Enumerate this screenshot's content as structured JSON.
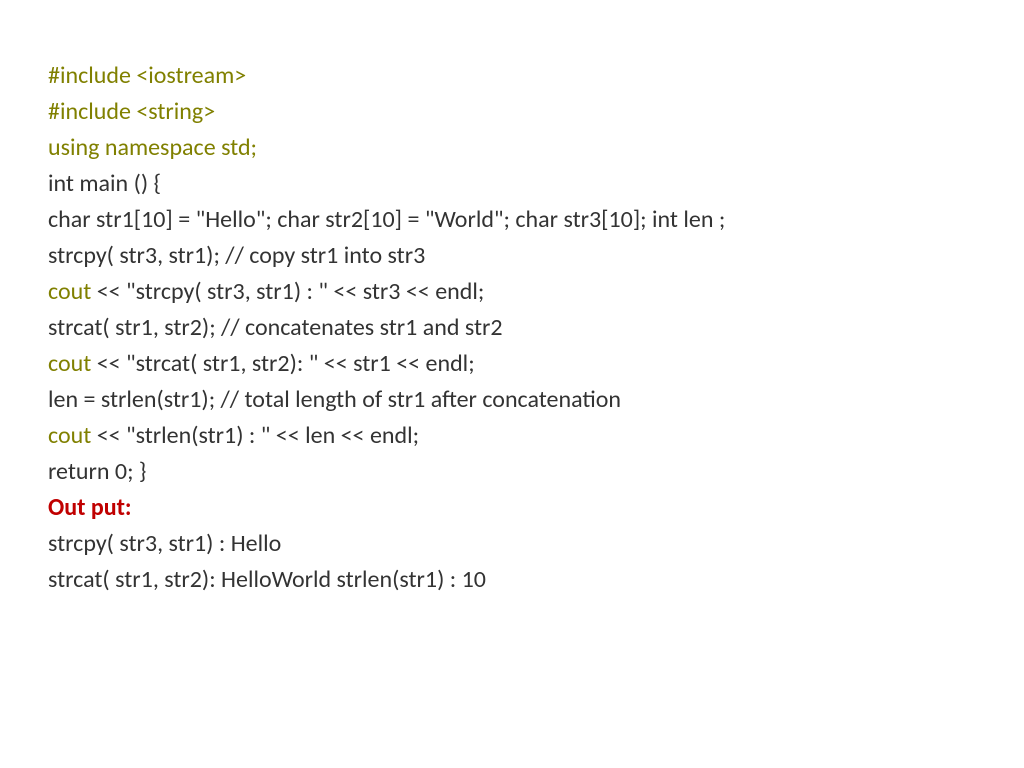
{
  "code": {
    "line1": "#include <iostream>",
    "line2": "#include <string>",
    "line3": "using namespace std;",
    "line4": "int main () {",
    "line5": "char str1[10] = \"Hello\";   char str2[10] = \"World\";   char str3[10];   int  len ;",
    "line6": "   strcpy( str3, str1);        // copy str1 into str3",
    "line7a": "cout",
    "line7b": " << \"strcpy( str3, str1) : \" << str3 << endl;",
    "line8": "  strcat( str1, str2);        // concatenates str1 and str2",
    "line9a": "cout",
    "line9b": " << \"strcat( str1, str2): \" << str1 << endl;",
    "line10": " len = strlen(str1);          // total length of str1 after concatenation",
    "line11a": "cout",
    "line11b": " << \"strlen(str1) : \" << len << endl;",
    "line12": "   return 0; }"
  },
  "output": {
    "label": "Out put:",
    "line1": "strcpy( str3, str1) : Hello",
    "line2": "strcat( str1, str2): HelloWorld strlen(str1) : 10"
  }
}
